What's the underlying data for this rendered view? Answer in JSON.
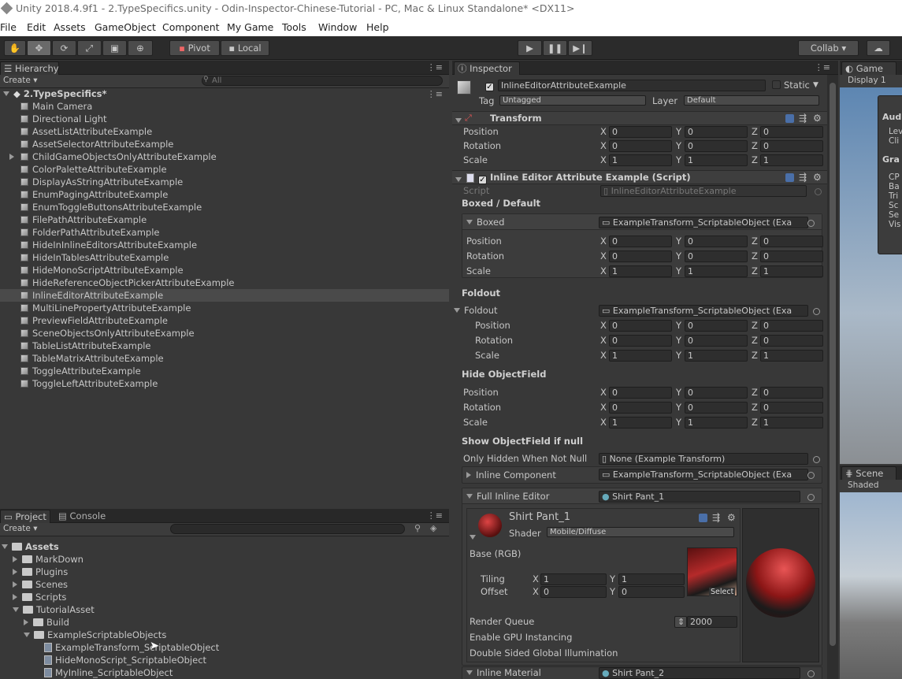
{
  "window": {
    "title": "Unity 2018.4.9f1 - 2.TypeSpecifics.unity - Odin-Inspector-Chinese-Tutorial - PC, Mac & Linux Standalone* <DX11>"
  },
  "menu": [
    "File",
    "Edit",
    "Assets",
    "GameObject",
    "Component",
    "My Game",
    "Tools",
    "Window",
    "Help"
  ],
  "toolbar": {
    "pivot": "Pivot",
    "local": "Local",
    "collab": "Collab ▾"
  },
  "hierarchy": {
    "tab": "Hierarchy",
    "create": "Create ▾",
    "search_placeholder": "All",
    "scene": "2.TypeSpecifics*",
    "items": [
      "Main Camera",
      "Directional Light",
      "AssetListAttributeExample",
      "AssetSelectorAttributeExample",
      "ChildGameObjectsOnlyAttributeExample",
      "ColorPaletteAttributeExample",
      "DisplayAsStringAttributeExample",
      "EnumPagingAttributeExample",
      "EnumToggleButtonsAttributeExample",
      "FilePathAttributeExample",
      "FolderPathAttributeExample",
      "HideInInlineEditorsAttributeExample",
      "HideInTablesAttributeExample",
      "HideMonoScriptAttributeExample",
      "HideReferenceObjectPickerAttributeExample",
      "InlineEditorAttributeExample",
      "MultiLinePropertyAttributeExample",
      "PreviewFieldAttributeExample",
      "SceneObjectsOnlyAttributeExample",
      "TableListAttributeExample",
      "TableMatrixAttributeExample",
      "ToggleAttributeExample",
      "ToggleLeftAttributeExample"
    ]
  },
  "project": {
    "tab": "Project",
    "console_tab": "Console",
    "create": "Create ▾",
    "items": [
      "Assets",
      "MarkDown",
      "Plugins",
      "Scenes",
      "Scripts",
      "TutorialAsset",
      "Build",
      "ExampleScriptableObjects",
      "ExampleTransform_ScriptableObject",
      "HideMonoScript_ScriptableObject",
      "MyInline_ScriptableObject"
    ]
  },
  "inspector": {
    "tab": "Inspector",
    "object_name": "InlineEditorAttributeExample",
    "static_label": "Static",
    "tag_label": "Tag",
    "tag_value": "Untagged",
    "layer_label": "Layer",
    "layer_value": "Default",
    "transform": {
      "title": "Transform",
      "position": "Position",
      "rotation": "Rotation",
      "scale": "Scale"
    },
    "script_component": {
      "title": "Inline Editor Attribute Example (Script)",
      "script_label": "Script",
      "script_value": "InlineEditorAttributeExample"
    },
    "boxed_default": "Boxed / Default",
    "boxed": "Boxed",
    "obj_ref": "ExampleTransform_ScriptableObject (Exa",
    "foldout_section": "Foldout",
    "foldout": "Foldout",
    "hide_objfield": "Hide ObjectField",
    "show_objfield": "Show ObjectField if null",
    "only_hidden": "Only Hidden When Not Null",
    "none_value": "None (Example Transform)",
    "inline_component": "Inline Component",
    "full_inline": "Full Inline Editor",
    "shirt1": "Shirt Pant_1",
    "shader_label": "Shader",
    "shader_value": "Mobile/Diffuse",
    "base_rgb": "Base (RGB)",
    "tiling": "Tiling",
    "offset": "Offset",
    "select": "Select",
    "render_queue": "Render Queue",
    "render_queue_value": "2000",
    "gpu_instancing": "Enable GPU Instancing",
    "double_sided": "Double Sided Global Illumination",
    "inline_material": "Inline Material",
    "shirt2": "Shirt Pant_2",
    "axes": {
      "x": "X",
      "y": "Y",
      "z": "Z"
    },
    "v0": "0",
    "v1": "1"
  },
  "game": {
    "tab": "Game",
    "display": "Display 1",
    "labels": [
      "Aud",
      "Lev",
      "Cli",
      "Gra",
      "CP",
      "Ba",
      "Tri",
      "Sc",
      "Se",
      "Vis"
    ]
  },
  "scene": {
    "tab": "Scene",
    "shaded": "Shaded"
  },
  "colors": {
    "selected_row": "#4a4a4a",
    "panel_bg": "#383838",
    "accent": "#3d6ea8"
  }
}
